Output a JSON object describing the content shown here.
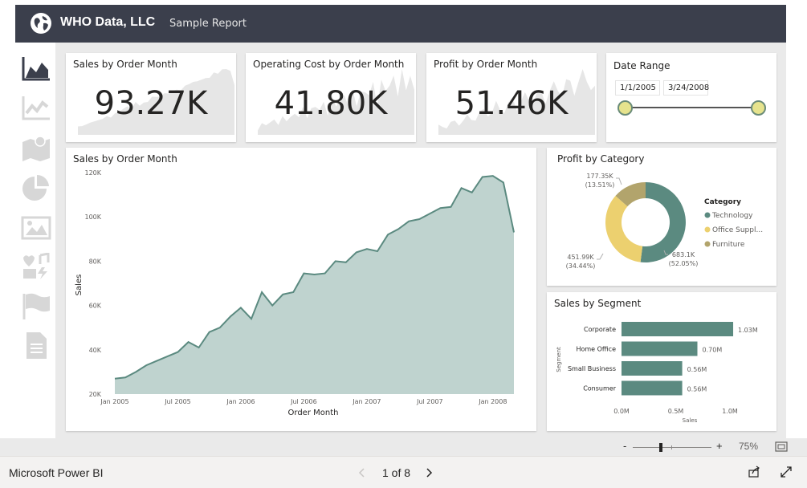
{
  "header": {
    "brand": "WHO Data, LLC",
    "subtitle": "Sample Report"
  },
  "nav_icons": [
    "area-chart-icon",
    "line-chart-icon",
    "map-icon",
    "pie-chart-icon",
    "image-icon",
    "media-icon",
    "flag-icon",
    "document-icon"
  ],
  "kpis": [
    {
      "title": "Sales by Order Month",
      "value": "93.27K"
    },
    {
      "title": "Operating Cost by Order Month",
      "value": "41.80K"
    },
    {
      "title": "Profit by Order Month",
      "value": "51.46K"
    }
  ],
  "date_range": {
    "title": "Date Range",
    "start": "1/1/2005",
    "end": "3/24/2008"
  },
  "sales_chart": {
    "title": "Sales by Order Month",
    "xlabel": "Order Month",
    "ylabel": "Sales"
  },
  "profit_category": {
    "title": "Profit by Category",
    "legend_title": "Category",
    "slices": [
      {
        "name": "Technology",
        "label_value": "683.1K",
        "label_pct": "(52.05%)"
      },
      {
        "name": "Office Suppl...",
        "label_value": "451.99K",
        "label_pct": "(34.44%)"
      },
      {
        "name": "Furniture",
        "label_value": "177.35K",
        "label_pct": "(13.51%)"
      }
    ]
  },
  "segment_chart": {
    "title": "Sales by Segment",
    "ylabel": "Segment",
    "xlabel": "Sales"
  },
  "chart_data": [
    {
      "type": "area",
      "title": "Sales by Order Month",
      "xlabel": "Order Month",
      "ylabel": "Sales",
      "x": [
        "2005-01",
        "2005-02",
        "2005-03",
        "2005-04",
        "2005-05",
        "2005-06",
        "2005-07",
        "2005-08",
        "2005-09",
        "2005-10",
        "2005-11",
        "2005-12",
        "2006-01",
        "2006-02",
        "2006-03",
        "2006-04",
        "2006-05",
        "2006-06",
        "2006-07",
        "2006-08",
        "2006-09",
        "2006-10",
        "2006-11",
        "2006-12",
        "2007-01",
        "2007-02",
        "2007-03",
        "2007-04",
        "2007-05",
        "2007-06",
        "2007-07",
        "2007-08",
        "2007-09",
        "2007-10",
        "2007-11",
        "2007-12",
        "2008-01",
        "2008-02",
        "2008-03"
      ],
      "values": [
        27000,
        27500,
        30000,
        33000,
        35000,
        37000,
        39000,
        43500,
        41000,
        48000,
        50000,
        55000,
        59000,
        54000,
        66000,
        60000,
        65000,
        66000,
        74500,
        74000,
        74500,
        80000,
        79500,
        84000,
        85500,
        84500,
        92000,
        94500,
        98000,
        99000,
        101500,
        104000,
        104500,
        113000,
        111000,
        118000,
        118500,
        115500,
        93000
      ],
      "ylim": [
        20000,
        120000
      ],
      "yticks": [
        "20K",
        "40K",
        "60K",
        "80K",
        "100K",
        "120K"
      ],
      "xticks": [
        "Jan 2005",
        "Jul 2005",
        "Jan 2006",
        "Jul 2006",
        "Jan 2007",
        "Jul 2007",
        "Jan 2008"
      ],
      "color": "#5b8a80",
      "fill": "#bfd3cf",
      "grid": false
    },
    {
      "type": "pie",
      "title": "Profit by Category",
      "labels": [
        "Technology",
        "Office Suppl...",
        "Furniture"
      ],
      "values": [
        683.1,
        451.99,
        177.35
      ],
      "percents": [
        52.05,
        34.44,
        13.51
      ],
      "colors": [
        "#5b8a80",
        "#ecd06f",
        "#b2a46c"
      ],
      "legend": "right"
    },
    {
      "type": "bar",
      "title": "Sales by Segment",
      "categories": [
        "Corporate",
        "Home Office",
        "Small Business",
        "Consumer"
      ],
      "values": [
        1.03,
        0.7,
        0.56,
        0.56
      ],
      "data_labels": [
        "1.03M",
        "0.70M",
        "0.56M",
        "0.56M"
      ],
      "xticks": [
        "0.0M",
        "0.5M",
        "1.0M"
      ],
      "xlim": [
        0,
        1.0
      ],
      "xlabel": "Sales",
      "ylabel": "Segment",
      "color": "#5b8a80"
    }
  ],
  "zoom": {
    "minus": "-",
    "plus": "+",
    "level": "75%"
  },
  "footer": {
    "app_name": "Microsoft Power BI",
    "page_indicator": "1 of 8"
  },
  "colors": {
    "header_bg": "#3b3f4c",
    "accent": "#5b8a80",
    "canvas_bg": "#eaeaea"
  }
}
